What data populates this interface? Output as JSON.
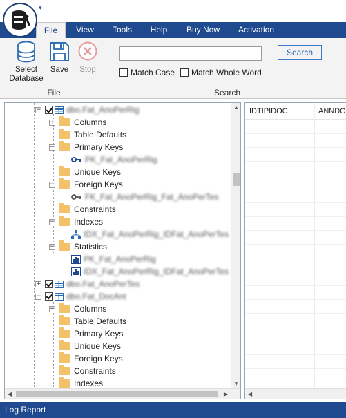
{
  "menu": {
    "items": [
      "File",
      "View",
      "Tools",
      "Help",
      "Buy Now",
      "Activation"
    ],
    "active": "File"
  },
  "ribbon": {
    "file_group": {
      "label": "File",
      "select_database": "Select Database",
      "save": "Save",
      "stop": "Stop"
    },
    "search_group": {
      "label": "Search",
      "input_value": "",
      "search_button": "Search",
      "match_case": "Match Case",
      "match_whole_word": "Match Whole Word"
    }
  },
  "tree": {
    "rows": [
      {
        "label": "dbo.Fat_AnoPerRig",
        "kind": "table",
        "blurred": true
      },
      {
        "label": "Columns",
        "kind": "folder"
      },
      {
        "label": "Table Defaults",
        "kind": "folder"
      },
      {
        "label": "Primary Keys",
        "kind": "folder"
      },
      {
        "label": "PK_Fat_AnoPerRig",
        "kind": "primary-key",
        "blurred": true
      },
      {
        "label": "Unique Keys",
        "kind": "folder"
      },
      {
        "label": "Foreign Keys",
        "kind": "folder"
      },
      {
        "label": "FK_Fat_AnoPerRig_Fat_AnoPerTes",
        "kind": "foreign-key",
        "blurred": true
      },
      {
        "label": "Constraints",
        "kind": "folder"
      },
      {
        "label": "Indexes",
        "kind": "folder"
      },
      {
        "label": "IDX_Fat_AnoPerRig_IDFat_AnoPerTes",
        "kind": "index",
        "blurred": true
      },
      {
        "label": "Statistics",
        "kind": "folder"
      },
      {
        "label": "PK_Fat_AnoPerRig",
        "kind": "statistic",
        "blurred": true
      },
      {
        "label": "IDX_Fat_AnoPerRig_IDFat_AnoPerTes",
        "kind": "statistic",
        "blurred": true
      },
      {
        "label": "dbo.Fat_AnoPerTes",
        "kind": "table",
        "blurred": true
      },
      {
        "label": "dbo.Fat_DocAnt",
        "kind": "table",
        "blurred": true
      },
      {
        "label": "Columns",
        "kind": "folder"
      },
      {
        "label": "Table Defaults",
        "kind": "folder"
      },
      {
        "label": "Primary Keys",
        "kind": "folder"
      },
      {
        "label": "Unique Keys",
        "kind": "folder"
      },
      {
        "label": "Foreign Keys",
        "kind": "folder"
      },
      {
        "label": "Constraints",
        "kind": "folder"
      },
      {
        "label": "Indexes",
        "kind": "folder"
      }
    ]
  },
  "grid": {
    "columns": [
      "IDTIPIDOC",
      "ANNDO"
    ]
  },
  "log": {
    "label": "Log Report"
  },
  "colors": {
    "accent": "#1f4a8f",
    "folder": "#f2c16a",
    "search_button_text": "#2f68b7"
  }
}
